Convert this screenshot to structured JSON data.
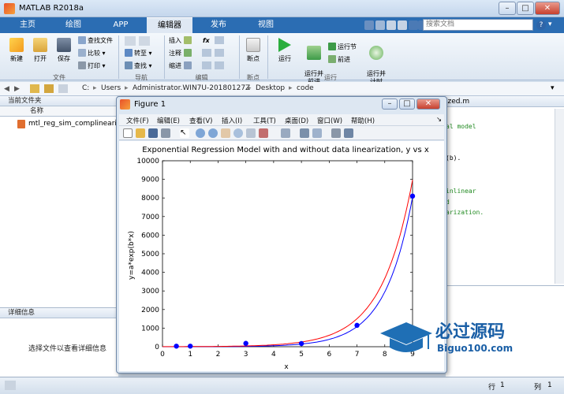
{
  "window": {
    "title": "MATLAB R2018a"
  },
  "tabs": [
    {
      "label": "主页",
      "active": false
    },
    {
      "label": "绘图",
      "active": false
    },
    {
      "label": "APP",
      "active": false
    },
    {
      "label": "编辑器",
      "active": true
    },
    {
      "label": "发布",
      "active": false
    },
    {
      "label": "视图",
      "active": false
    }
  ],
  "search": {
    "placeholder": "搜索文档"
  },
  "ribbon": {
    "file": {
      "new": "新建",
      "open": "打开",
      "save": "保存",
      "find_files": "查找文件",
      "compare": "比较",
      "print": "打印",
      "group": "文件"
    },
    "navigate": {
      "goto": "转至",
      "find": "查找",
      "group": "导航"
    },
    "edit": {
      "insert": "插入",
      "comment": "注释",
      "indent": "缩进",
      "fx": "fx",
      "group": "编辑"
    },
    "breakpoints": {
      "label": "断点",
      "group": "断点"
    },
    "run": {
      "run": "运行",
      "run_advance": "运行并\n前进",
      "run_section": "运行节",
      "advance": "前进",
      "run_time": "运行并\n计时",
      "group": "运行"
    }
  },
  "address": {
    "parts": [
      "C:",
      "Users",
      "Administrator.WIN7U-20180127Z",
      "Desktop",
      "code"
    ]
  },
  "left_panel": {
    "title": "当前文件夹",
    "col_header": "名称",
    "file": "mtl_reg_sim_complinearize",
    "details_title": "详细信息",
    "details_text": "选择文件以查看详细信息"
  },
  "editor": {
    "tab": "ized.m",
    "lines": [
      "al model",
      "(b).",
      "inlinear",
      "d",
      "arization."
    ]
  },
  "status": {
    "row_label": "行",
    "row": "1",
    "col_label": "列",
    "col": "1"
  },
  "figure": {
    "title": "Figure 1",
    "menu": [
      "文件(F)",
      "编辑(E)",
      "查看(V)",
      "插入(I)",
      "工具(T)",
      "桌面(D)",
      "窗口(W)",
      "帮助(H)"
    ]
  },
  "watermark": {
    "text1": "必过源码",
    "text2": "Biguo100.com"
  },
  "chart_data": {
    "type": "line",
    "title": "Exponential Regression Model with and without data linearization, y vs x",
    "xlabel": "x",
    "ylabel": "y=a*exp(b*x)",
    "xlim": [
      0,
      9
    ],
    "ylim": [
      0,
      10000
    ],
    "xticks": [
      0,
      1,
      2,
      3,
      4,
      5,
      6,
      7,
      8,
      9
    ],
    "yticks": [
      0,
      1000,
      2000,
      3000,
      4000,
      5000,
      6000,
      7000,
      8000,
      9000,
      10000
    ],
    "points": {
      "x": [
        0.5,
        1,
        3,
        5,
        7,
        9
      ],
      "y": [
        30,
        30,
        180,
        170,
        1150,
        8100
      ],
      "color": "#0000ff"
    },
    "series": [
      {
        "color": "#0000ff",
        "a": 0.95,
        "b": 1.005,
        "x_end": 9
      },
      {
        "color": "#ff0000",
        "a": 2.9,
        "b": 0.893,
        "x_end": 9
      }
    ]
  }
}
